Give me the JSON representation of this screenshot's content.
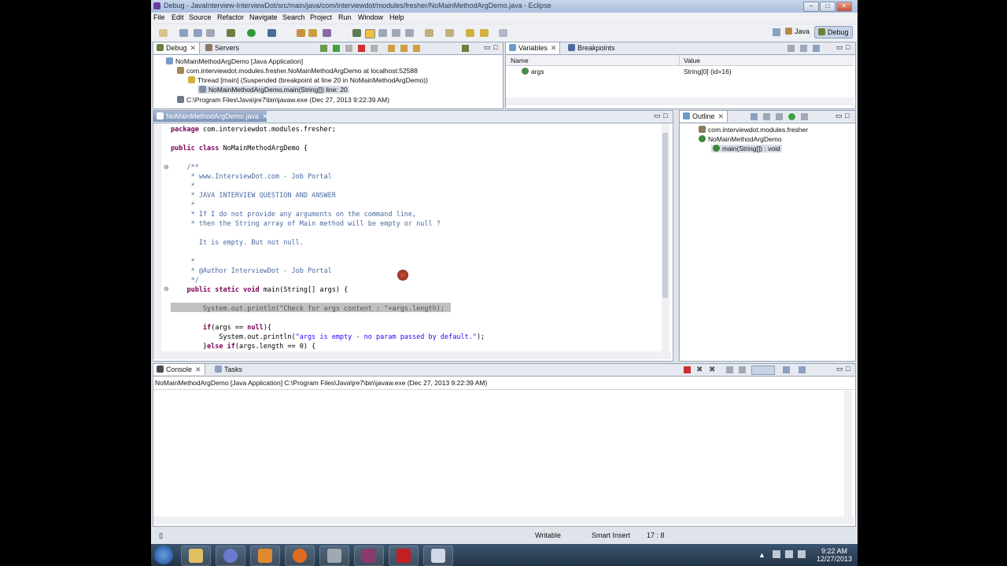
{
  "window": {
    "title": "Debug - JavaInterview-InterviewDot/src/main/java/com/interviewdot/modules/fresher/NoMainMethodArgDemo.java - Eclipse"
  },
  "menu": [
    "File",
    "Edit",
    "Source",
    "Refactor",
    "Navigate",
    "Search",
    "Project",
    "Run",
    "Window",
    "Help"
  ],
  "perspectives": {
    "java": "Java",
    "debug": "Debug"
  },
  "debug": {
    "tabs": [
      "Debug",
      "Servers"
    ],
    "items": [
      "NoMainMethodArgDemo [Java Application]",
      "com.interviewdot.modules.fresher.NoMainMethodArgDemo at localhost:52588",
      "Thread [main] (Suspended (breakpoint at line 20 in NoMainMethodArgDemo))",
      "NoMainMethodArgDemo.main(String[]) line: 20",
      "C:\\Program Files\\Java\\jre7\\bin\\javaw.exe (Dec 27, 2013 9:22:39 AM)"
    ]
  },
  "variables": {
    "tabs": [
      "Variables",
      "Breakpoints"
    ],
    "headers": [
      "Name",
      "Value"
    ],
    "rows": [
      {
        "name": "args",
        "value": "String[0]  (id=16)"
      }
    ]
  },
  "editor": {
    "tab": "NoMainMethodArgDemo.java",
    "lines": [
      "package com.interviewdot.modules.fresher;",
      "",
      "public class NoMainMethodArgDemo {",
      "",
      "    /**",
      "     * www.InterviewDot.com - Job Portal",
      "     *",
      "     * JAVA INTERVIEW QUESTION AND ANSWER",
      "     *",
      "     * If I do not provide any arguments on the command line,",
      "     * then the String array of Main method will be empty or null ?",
      "",
      "       It is empty. But not null.",
      "",
      "     *",
      "     * @Author InterviewDot - Job Portal",
      "     */",
      "    public static void main(String[] args) {",
      "",
      "        System.out.println(\"Check for args content : \"+args.length);",
      "",
      "        if(args == null){",
      "            System.out.println(\"args is empty - no param passed by default.\");",
      "        }else if(args.length == 0) {"
    ]
  },
  "outline": {
    "tab": "Outline",
    "items": [
      "com.interviewdot.modules.fresher",
      "NoMainMethodArgDemo",
      "main(String[]) : void"
    ]
  },
  "console": {
    "tabs": [
      "Console",
      "Tasks"
    ],
    "header": "NoMainMethodArgDemo [Java Application] C:\\Program Files\\Java\\jre7\\bin\\javaw.exe (Dec 27, 2013 9:22:39 AM)"
  },
  "status": {
    "writable": "Writable",
    "insert": "Smart Insert",
    "position": "17 : 8"
  },
  "clock": {
    "time": "9:22 AM",
    "date": "12/27/2013"
  },
  "colors": {
    "accent": "#7d95bb",
    "highlight": "#c0c0c0",
    "keyword": "#7a0055",
    "comment": "#4a6aa0",
    "string": "#2a00ff"
  }
}
